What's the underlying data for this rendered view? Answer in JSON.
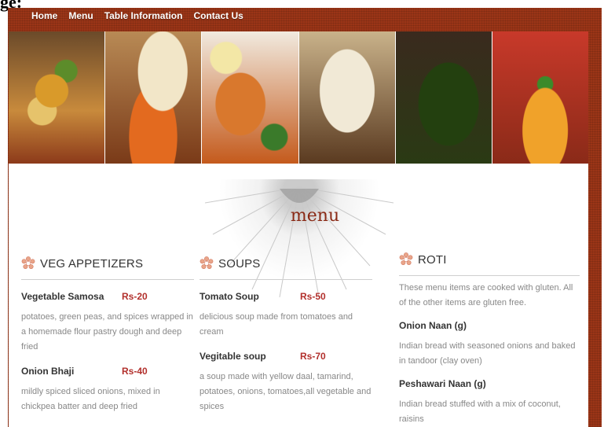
{
  "page_cut_text": "ge:",
  "nav": {
    "items": [
      "Home",
      "Menu",
      "Table Information",
      "Contact Us"
    ]
  },
  "menu_heading": "menu",
  "columns": {
    "veg": {
      "title": "VEG APPETIZERS",
      "items": [
        {
          "name": "Vegetable Samosa",
          "price": "Rs-20",
          "desc": "potatoes, green peas, and spices wrapped in a homemade flour pastry dough and deep fried"
        },
        {
          "name": "Onion Bhaji",
          "price": "Rs-40",
          "desc": "mildly spiced sliced onions, mixed in chickpea batter and deep fried"
        }
      ]
    },
    "soups": {
      "title": "SOUPS",
      "items": [
        {
          "name": "Tomato Soup",
          "price": "Rs-50",
          "desc": "delicious soup made from tomatoes and cream"
        },
        {
          "name": "Vegitable soup",
          "price": "Rs-70",
          "desc": "a soup made with yellow daal, tamarind, potatoes, onions, tomatoes,all vegetable and spices"
        }
      ]
    },
    "roti": {
      "title": "ROTI",
      "note": "These menu items are cooked with gluten. All of the other items are gluten free.",
      "items": [
        {
          "name": "Onion Naan (g)",
          "desc": "Indian bread with seasoned onions and baked in tandoor (clay oven)"
        },
        {
          "name": "Peshawari Naan (g)",
          "desc": "Indian bread stuffed with a mix of coconut, raisins"
        }
      ]
    }
  },
  "colors": {
    "frame": "#9b3517",
    "price": "#b2302c",
    "heading": "#8a2a16"
  }
}
